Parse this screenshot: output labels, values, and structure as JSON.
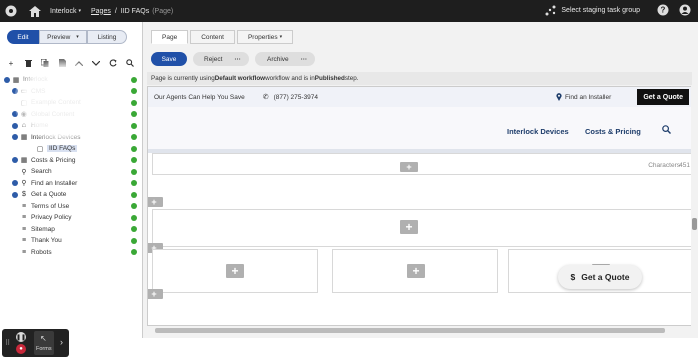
{
  "topbar": {
    "site": "Interlock",
    "crumb_pages": "Pages",
    "crumb_page": "IID FAQs",
    "crumb_type": "(Page)",
    "staging": "Select staging task group"
  },
  "left": {
    "modes": [
      "Edit",
      "Preview",
      "Listing"
    ],
    "tree": [
      {
        "label": "Interlock",
        "icon": "site-icon",
        "level": 0
      },
      {
        "label": "CMS",
        "icon": "folder-icon",
        "level": 1
      },
      {
        "label": "Example Content",
        "icon": "page-icon",
        "level": 1
      },
      {
        "label": "Global Content",
        "icon": "globe-icon",
        "level": 1
      },
      {
        "label": "Home",
        "icon": "home-icon",
        "level": 1
      },
      {
        "label": "Interlock Devices",
        "icon": "section-icon",
        "level": 1
      },
      {
        "label": "IID FAQs",
        "icon": "page-icon",
        "level": 2,
        "selected": true
      },
      {
        "label": "Costs & Pricing",
        "icon": "section-icon",
        "level": 1
      },
      {
        "label": "Search",
        "icon": "search-icon",
        "level": 1
      },
      {
        "label": "Find an Installer",
        "icon": "pin-icon",
        "level": 1
      },
      {
        "label": "Get a Quote",
        "icon": "dollar-icon",
        "level": 1
      },
      {
        "label": "Terms of Use",
        "icon": "doc-icon",
        "level": 1
      },
      {
        "label": "Privacy Policy",
        "icon": "doc-icon",
        "level": 1
      },
      {
        "label": "Sitemap",
        "icon": "doc-icon",
        "level": 1
      },
      {
        "label": "Thank You",
        "icon": "doc-icon",
        "level": 1
      },
      {
        "label": "Robots",
        "icon": "doc-icon",
        "level": 1
      }
    ],
    "dock_label": "Forms"
  },
  "editor": {
    "tabs": [
      "Page",
      "Content",
      "Properties"
    ],
    "save": "Save",
    "reject": "Reject",
    "archive": "Archive",
    "workflow_pre": "Page is currently using ",
    "workflow_name": "Default workflow",
    "workflow_mid": " workflow and is in ",
    "workflow_state": "Published",
    "workflow_post": " step.",
    "site_tagline": "Our Agents Can Help You Save",
    "site_phone": "(877) 275-3974",
    "site_installer": "Find an Installer",
    "site_quote": "Get a Quote",
    "nav": [
      "Interlock Devices",
      "Costs & Pricing"
    ],
    "characters_label": "Characters",
    "characters_value": "451",
    "float_quote": "Get a Quote"
  },
  "colors": {
    "primary": "#2050a8",
    "ok": "#3aa836",
    "topbar": "#1e1e1e"
  }
}
